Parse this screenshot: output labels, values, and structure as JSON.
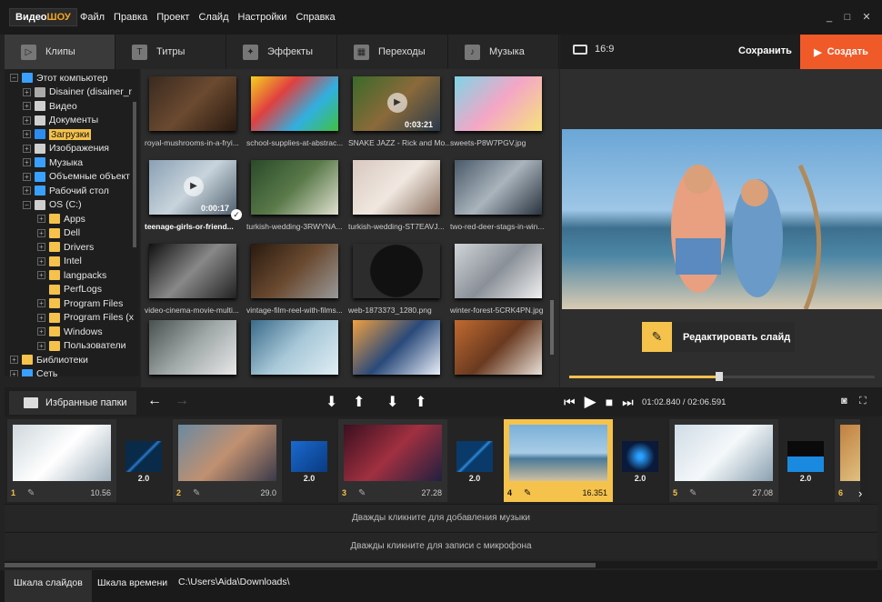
{
  "app": {
    "logo_a": "Видео",
    "logo_b": "ШОУ"
  },
  "menu": [
    "Файл",
    "Правка",
    "Проект",
    "Слайд",
    "Настройки",
    "Справка"
  ],
  "tabs": [
    {
      "label": "Клипы",
      "icon": "play-icon"
    },
    {
      "label": "Титры",
      "icon": "text-icon"
    },
    {
      "label": "Эффекты",
      "icon": "wand-icon"
    },
    {
      "label": "Переходы",
      "icon": "film-icon"
    },
    {
      "label": "Музыка",
      "icon": "music-icon"
    }
  ],
  "preview": {
    "aspect": "16:9",
    "save_label": "Сохранить",
    "create_label": "Создать",
    "edit_label": "Редактировать слайд",
    "time": "01:02.840 / 02:06.591",
    "progress": 0.49
  },
  "tree": [
    {
      "label": "Этот компьютер",
      "level": 0,
      "exp": "−",
      "color": "#3aa0ff"
    },
    {
      "label": "Disainer (disainer_r",
      "level": 1,
      "exp": "+",
      "color": "#aaaaaa"
    },
    {
      "label": "Видео",
      "level": 1,
      "exp": "+",
      "color": "#cfcfcf"
    },
    {
      "label": "Документы",
      "level": 1,
      "exp": "+",
      "color": "#cfcfcf"
    },
    {
      "label": "Загрузки",
      "level": 1,
      "exp": "+",
      "color": "#2d8cf0",
      "selected": true
    },
    {
      "label": "Изображения",
      "level": 1,
      "exp": "+",
      "color": "#cfcfcf"
    },
    {
      "label": "Музыка",
      "level": 1,
      "exp": "+",
      "color": "#3aa0ff"
    },
    {
      "label": "Объемные объект",
      "level": 1,
      "exp": "+",
      "color": "#3aa0ff"
    },
    {
      "label": "Рабочий стол",
      "level": 1,
      "exp": "+",
      "color": "#3aa0ff"
    },
    {
      "label": "OS (C:)",
      "level": 1,
      "exp": "−",
      "color": "#cfcfcf"
    },
    {
      "label": "Apps",
      "level": 2,
      "exp": "+",
      "color": "#f5c24b"
    },
    {
      "label": "Dell",
      "level": 2,
      "exp": "+",
      "color": "#f5c24b"
    },
    {
      "label": "Drivers",
      "level": 2,
      "exp": "+",
      "color": "#f5c24b"
    },
    {
      "label": "Intel",
      "level": 2,
      "exp": "+",
      "color": "#f5c24b"
    },
    {
      "label": "langpacks",
      "level": 2,
      "exp": "+",
      "color": "#f5c24b"
    },
    {
      "label": "PerfLogs",
      "level": 2,
      "exp": "",
      "color": "#f5c24b"
    },
    {
      "label": "Program Files",
      "level": 2,
      "exp": "+",
      "color": "#f5c24b"
    },
    {
      "label": "Program Files (x",
      "level": 2,
      "exp": "+",
      "color": "#f5c24b"
    },
    {
      "label": "Windows",
      "level": 2,
      "exp": "+",
      "color": "#f5c24b"
    },
    {
      "label": "Пользователи",
      "level": 2,
      "exp": "+",
      "color": "#f5c24b"
    },
    {
      "label": "Библиотеки",
      "level": 0,
      "exp": "+",
      "color": "#f5c24b"
    },
    {
      "label": "Сеть",
      "level": 0,
      "exp": "+",
      "color": "#3aa0ff"
    }
  ],
  "files": [
    {
      "name": "royal-mushrooms-in-a-fryi...",
      "bg": "linear-gradient(135deg,#3a2a20,#6b4a30,#2a1a10)"
    },
    {
      "name": "school-supplies-at-abstrac...",
      "bg": "linear-gradient(135deg,#f5d020,#e04040,#30b0e0,#40c040)"
    },
    {
      "name": "SNAKE JAZZ - Rick and Mo...",
      "bg": "linear-gradient(135deg,#3a6a2a,#8a6a3a,#2a3a4a)",
      "duration": "0:03:21"
    },
    {
      "name": "sweets-P8W7PGV.jpg",
      "bg": "linear-gradient(135deg,#7fd4e6,#f4a6c6,#f6e27a)"
    },
    {
      "name": "teenage-girls-or-friend...",
      "bg": "linear-gradient(135deg,#8aa0b4,#c8d4dc,#50606e)",
      "duration": "0:00:17",
      "bold": true
    },
    {
      "name": "turkish-wedding-3RWYNA...",
      "bg": "linear-gradient(135deg,#2a4a2a,#5a7a4a,#e0e0d0)"
    },
    {
      "name": "turkish-wedding-ST7EAVJ...",
      "bg": "linear-gradient(135deg,#d8c8c0,#f0e8e0,#8a7060)"
    },
    {
      "name": "two-red-deer-stags-in-win...",
      "bg": "linear-gradient(135deg,#4a5a6a,#aab4bc,#2a3440)"
    },
    {
      "name": "video-cinema-movie-multi...",
      "bg": "linear-gradient(135deg,#111,#888,#222)"
    },
    {
      "name": "vintage-film-reel-with-films...",
      "bg": "linear-gradient(135deg,#2a1a10,#6a4a30,#999)"
    },
    {
      "name": "web-1873373_1280.png",
      "bg": "radial-gradient(circle,#111 50%,#2c2c2c 52%)"
    },
    {
      "name": "winter-forest-5CRK4PN.jpg",
      "bg": "linear-gradient(135deg,#d0d4d8,#8a9098,#f0f0f0)"
    },
    {
      "name": "",
      "bg": "linear-gradient(135deg,#4a5050,#a0a8a8,#e8e8e8)"
    },
    {
      "name": "",
      "bg": "linear-gradient(135deg,#3a6a8a,#a8c8d8,#e0eef4)"
    },
    {
      "name": "",
      "bg": "linear-gradient(135deg,#f0a040,#2a4a7a,#e8eef8)"
    },
    {
      "name": "",
      "bg": "linear-gradient(135deg,#c06a30,#6a3a20,#e8e0d8)"
    }
  ],
  "favorites_label": "Избранные папки",
  "slides": [
    {
      "num": "1",
      "dur": "10.56",
      "bg": "linear-gradient(135deg,#cfd8dc,#ffffff,#a0b0bc)"
    },
    {
      "num": "2",
      "dur": "29.0",
      "bg": "linear-gradient(135deg,#6a8aa0,#c09070,#3a3a4a)"
    },
    {
      "num": "3",
      "dur": "27.28",
      "bg": "linear-gradient(135deg,#3a1020,#a03040,#202040)"
    },
    {
      "num": "4",
      "dur": "16.351",
      "bg": "linear-gradient(#7ab0d8,#a8cce6 50%,#4a7a9a 60%,#cfc0a0)",
      "active": true
    },
    {
      "num": "5",
      "dur": "27.08",
      "bg": "linear-gradient(135deg,#d0dce6,#f4f8fa,#8aa0b0)"
    },
    {
      "num": "6",
      "dur": "",
      "bg": "linear-gradient(135deg,#c08040,#e0c080)"
    }
  ],
  "transitions": [
    {
      "dur": "2.0",
      "bg": "linear-gradient(135deg,#0a2a4a 45%,#2a7ac8 50%,#0a2a4a 55%)"
    },
    {
      "dur": "2.0",
      "bg": "linear-gradient(135deg,#1a6ad0,#0a3a80)"
    },
    {
      "dur": "2.0",
      "bg": "linear-gradient(135deg,#0a3a6a 45%,#2a8ad8 50%,#0a3a6a 55%)"
    },
    {
      "dur": "2.0",
      "bg": "radial-gradient(circle,#2aa0ff 10%,#0a1a3a 60%)"
    },
    {
      "dur": "2.0",
      "bg": "linear-gradient(#0a0a0a 50%,#1a8ae0 50%)"
    }
  ],
  "tracks": {
    "music": "Дважды кликните для добавления музыки",
    "mic": "Дважды кликните для записи с микрофона"
  },
  "status": {
    "slides_tab": "Шкала слайдов",
    "time_tab": "Шкала времени",
    "path": "C:\\Users\\Aida\\Downloads\\"
  }
}
